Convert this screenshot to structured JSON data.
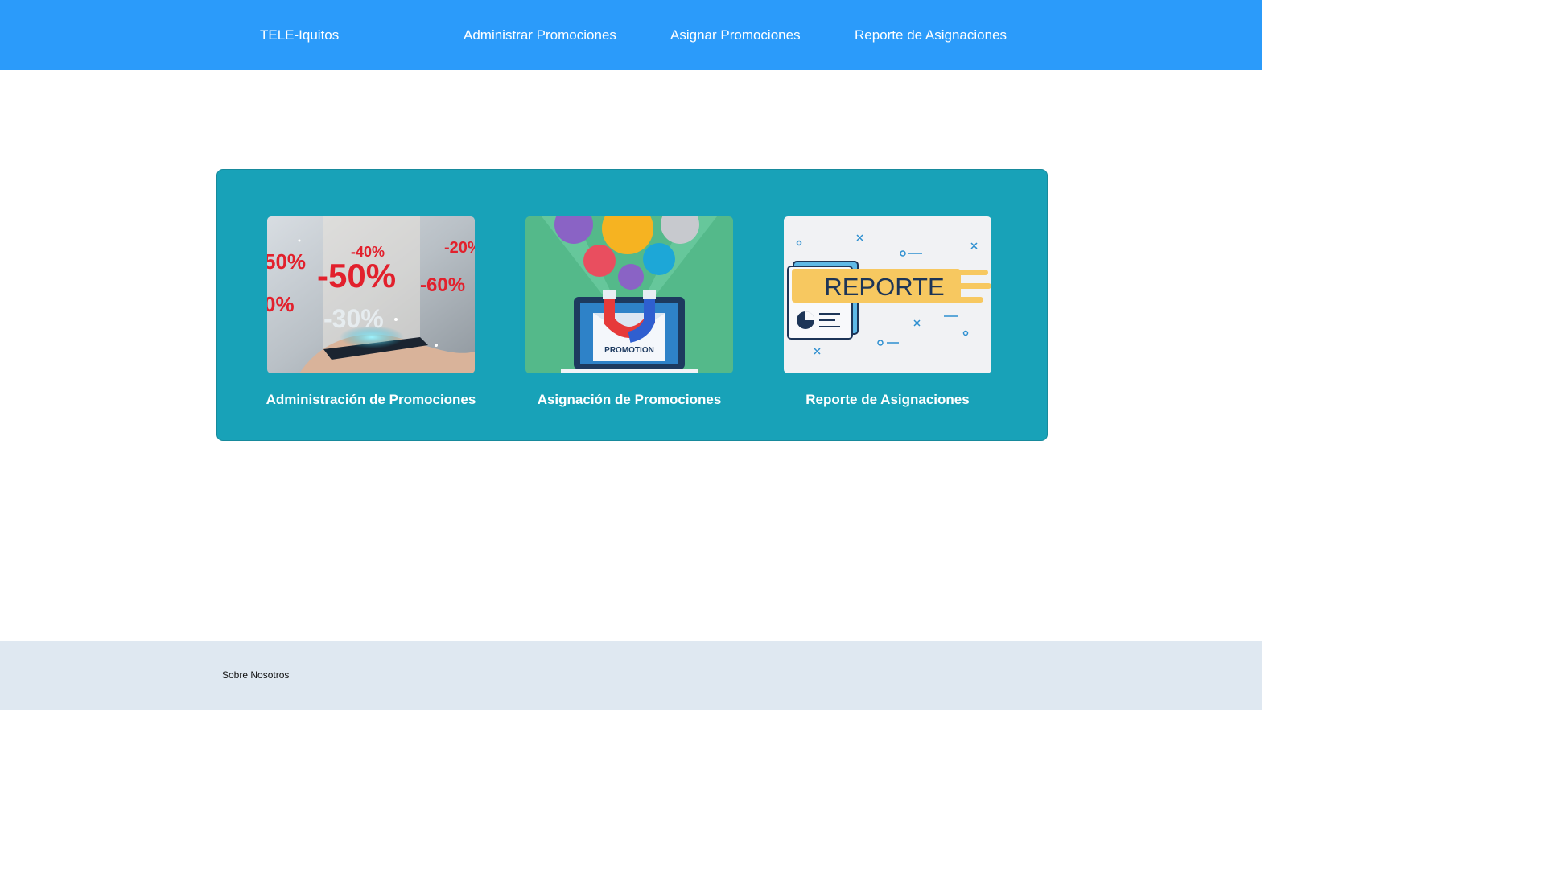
{
  "navbar": {
    "brand": "TELE-Iquitos",
    "links": [
      "Administrar Promociones",
      "Asignar Promociones",
      "Reporte de Asignaciones"
    ],
    "background": "#2b9bfa"
  },
  "panel": {
    "background": "#18a2b8",
    "cards": [
      {
        "title": "Administración de Promociones",
        "image": "promotions-phone-image",
        "image_text": [
          "-50%",
          "-40%",
          "-20%",
          "-30%",
          "-60%",
          "50%",
          "0%"
        ]
      },
      {
        "title": "Asignación de Promociones",
        "image": "promotion-magnet-image",
        "image_text": [
          "PROMOTION"
        ]
      },
      {
        "title": "Reporte de Asignaciones",
        "image": "report-document-image",
        "image_text": [
          "REPORTE"
        ]
      }
    ]
  },
  "footer": {
    "link": "Sobre Nosotros",
    "background": "#dfe8f1"
  }
}
